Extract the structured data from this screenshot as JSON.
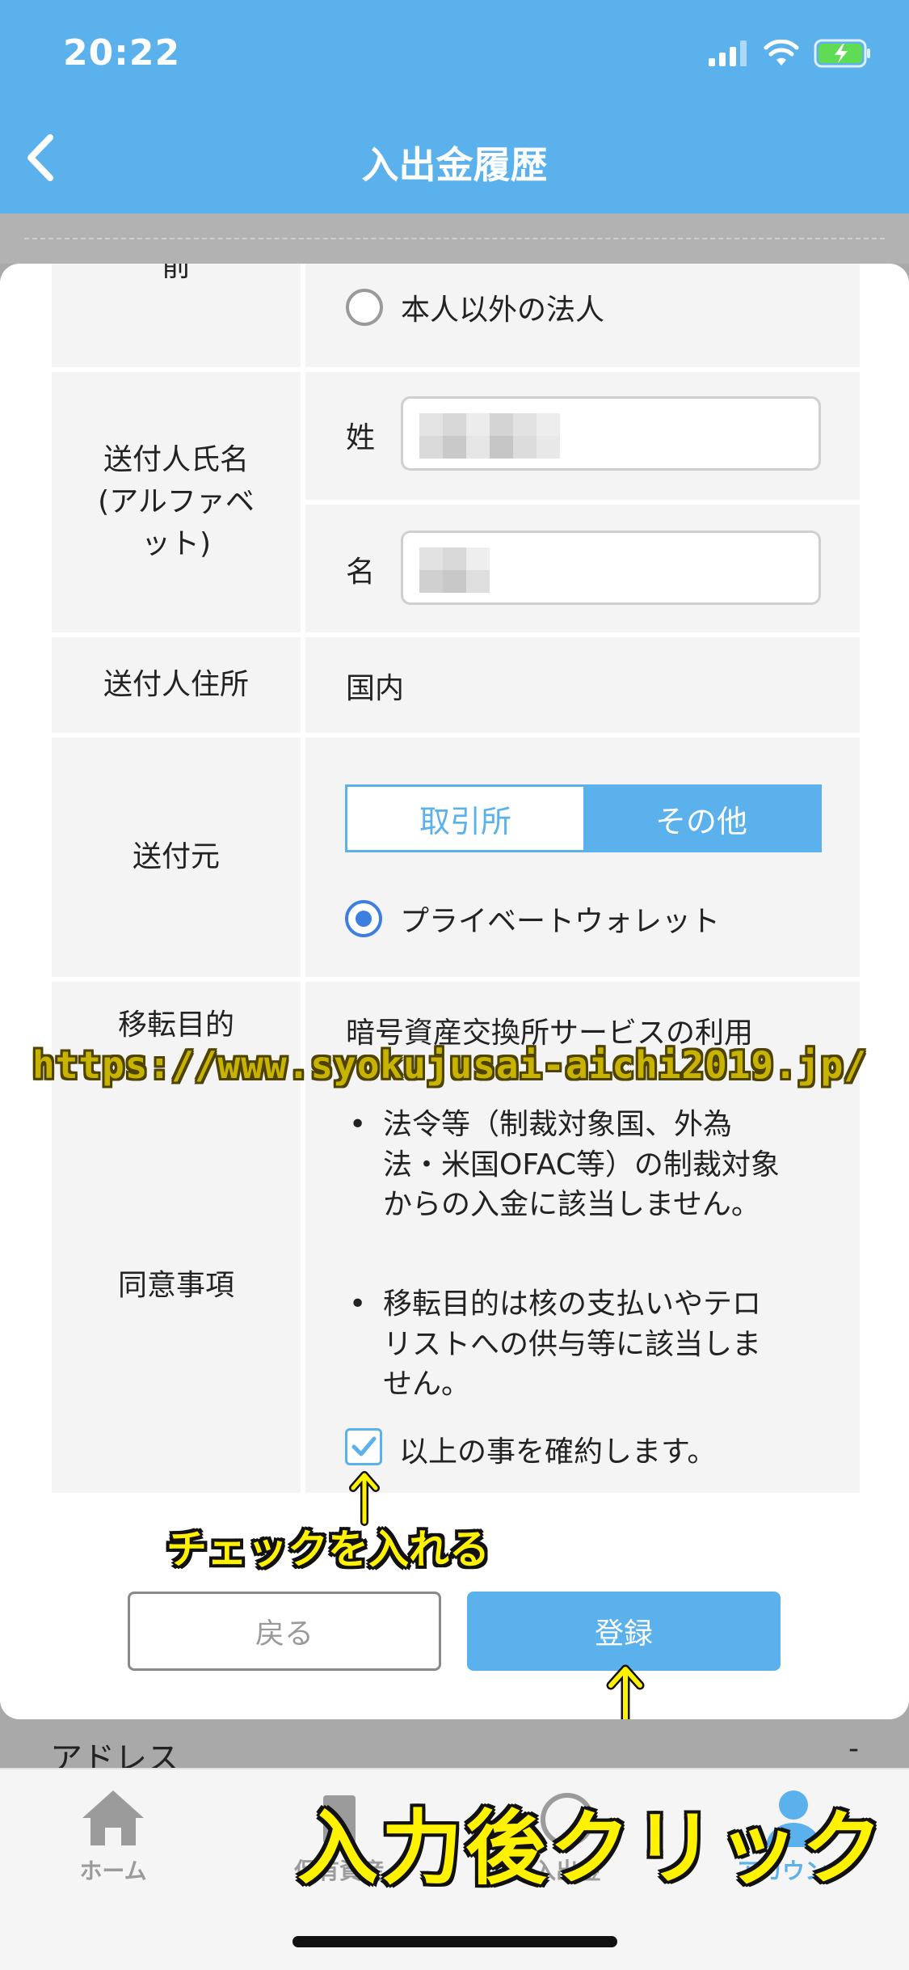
{
  "status_bar": {
    "time": "20:22"
  },
  "header": {
    "title": "入出金履歴"
  },
  "form": {
    "top_label_partial": "前",
    "corp_option": "本人以外の法人",
    "sender_name_label": [
      "送付人氏名",
      "(アルファベ",
      "ット)"
    ],
    "last_name_label": "姓",
    "first_name_label": "名",
    "address_label": "送付人住所",
    "address_value": "国内",
    "source_label": "送付元",
    "source_tabs": [
      "取引所",
      "その他"
    ],
    "source_selected": "その他",
    "wallet_option": "プライベートウォレット",
    "purpose_label": "移転目的",
    "purpose_value": "暗号資産交換所サービスの利用",
    "consent_label": "同意事項",
    "consent_items": [
      "法令等（制裁対象国、外為法・米国OFAC等）の制裁対象からの入金に該当しません。",
      "移転目的は核の支払いやテロリストへの供与等に該当しません。"
    ],
    "agree_label": "以上の事を確約します。",
    "agree_checked": true,
    "back_button": "戻る",
    "submit_button": "登録"
  },
  "below": {
    "address_label": "アドレス",
    "address_value": "-"
  },
  "tabbar": {
    "items": [
      "ホーム",
      "保有資産",
      "入出金",
      "アカウント"
    ],
    "active": "アカウント"
  },
  "annotations": {
    "url": "https://www.syokujusai-aichi2019.jp/",
    "check_hint": "チェックを入れる",
    "click_hint": "入力後クリック"
  },
  "colors": {
    "primary": "#5ab1ec",
    "radio": "#3d7fe0",
    "annotation": "#fff200"
  }
}
